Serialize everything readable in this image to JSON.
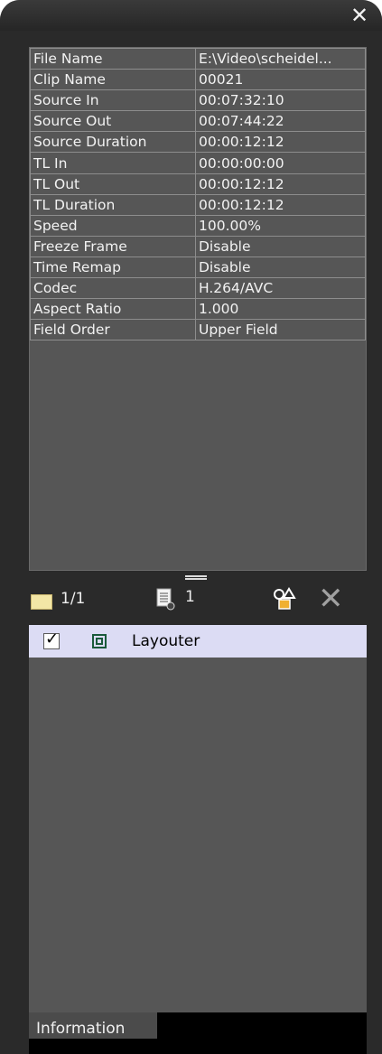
{
  "window": {
    "close_glyph": "✕"
  },
  "properties": [
    {
      "key": "File Name",
      "value": "E:\\Video\\scheidel..."
    },
    {
      "key": "Clip Name",
      "value": "00021"
    },
    {
      "key": "Source In",
      "value": "00:07:32:10"
    },
    {
      "key": "Source Out",
      "value": "00:07:44:22"
    },
    {
      "key": "Source Duration",
      "value": "00:00:12:12"
    },
    {
      "key": "TL In",
      "value": "00:00:00:00"
    },
    {
      "key": "TL Out",
      "value": "00:00:12:12"
    },
    {
      "key": "TL Duration",
      "value": "00:00:12:12"
    },
    {
      "key": "Speed",
      "value": "100.00%"
    },
    {
      "key": "Freeze Frame",
      "value": "Disable"
    },
    {
      "key": "Time Remap",
      "value": "Disable"
    },
    {
      "key": "Codec",
      "value": "H.264/AVC"
    },
    {
      "key": "Aspect Ratio",
      "value": "1.000"
    },
    {
      "key": "Field Order",
      "value": "Upper Field"
    }
  ],
  "toolbar": {
    "clip_count": "1/1",
    "file_count": "1",
    "close_glyph": "✕"
  },
  "effects": [
    {
      "label": "Layouter",
      "checked": true
    }
  ],
  "tabs": {
    "information": "Information"
  }
}
